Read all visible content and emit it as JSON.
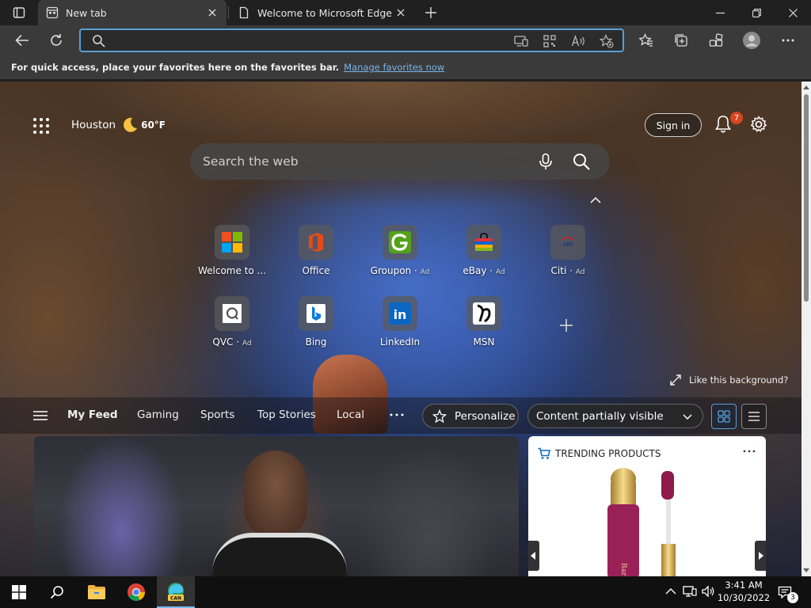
{
  "browser": {
    "tabs": [
      {
        "label": "New tab",
        "active": true
      },
      {
        "label": "Welcome to Microsoft Edge Canary",
        "active": false
      }
    ],
    "address": {
      "value": "",
      "placeholder": ""
    },
    "favorites_bar": {
      "message": "For quick access, place your favorites here on the favorites bar.",
      "link": "Manage favorites now"
    }
  },
  "newtab": {
    "weather": {
      "city": "Houston",
      "temp": "60°F"
    },
    "sign_in": "Sign in",
    "notifications_count": "7",
    "search_placeholder": "Search the web",
    "quick_links": [
      {
        "label": "Welcome to ...",
        "ad": ""
      },
      {
        "label": "Office",
        "ad": ""
      },
      {
        "label": "Groupon",
        "ad": "Ad"
      },
      {
        "label": "eBay",
        "ad": "Ad"
      },
      {
        "label": "Citi",
        "ad": "Ad"
      },
      {
        "label": "QVC",
        "ad": "Ad"
      },
      {
        "label": "Bing",
        "ad": ""
      },
      {
        "label": "LinkedIn",
        "ad": ""
      },
      {
        "label": "MSN",
        "ad": ""
      }
    ],
    "like_background": "Like this background?",
    "feed_nav": [
      "My Feed",
      "Gaming",
      "Sports",
      "Top Stories",
      "Local"
    ],
    "personalize": "Personalize",
    "content_visibility": "Content partially visible",
    "trending": {
      "title": "TRENDING PRODUCTS",
      "product_text": "Rare B"
    }
  },
  "taskbar": {
    "clock_time": "3:41 AM",
    "clock_date": "10/30/2022",
    "notification_count": "3",
    "edge_badge": "CAN"
  },
  "colors": {
    "accent": "#5a9fd6",
    "link": "#7ab4ea",
    "badge": "#d64621",
    "titlebar": "#202020",
    "toolbar": "#3a3a3a"
  }
}
